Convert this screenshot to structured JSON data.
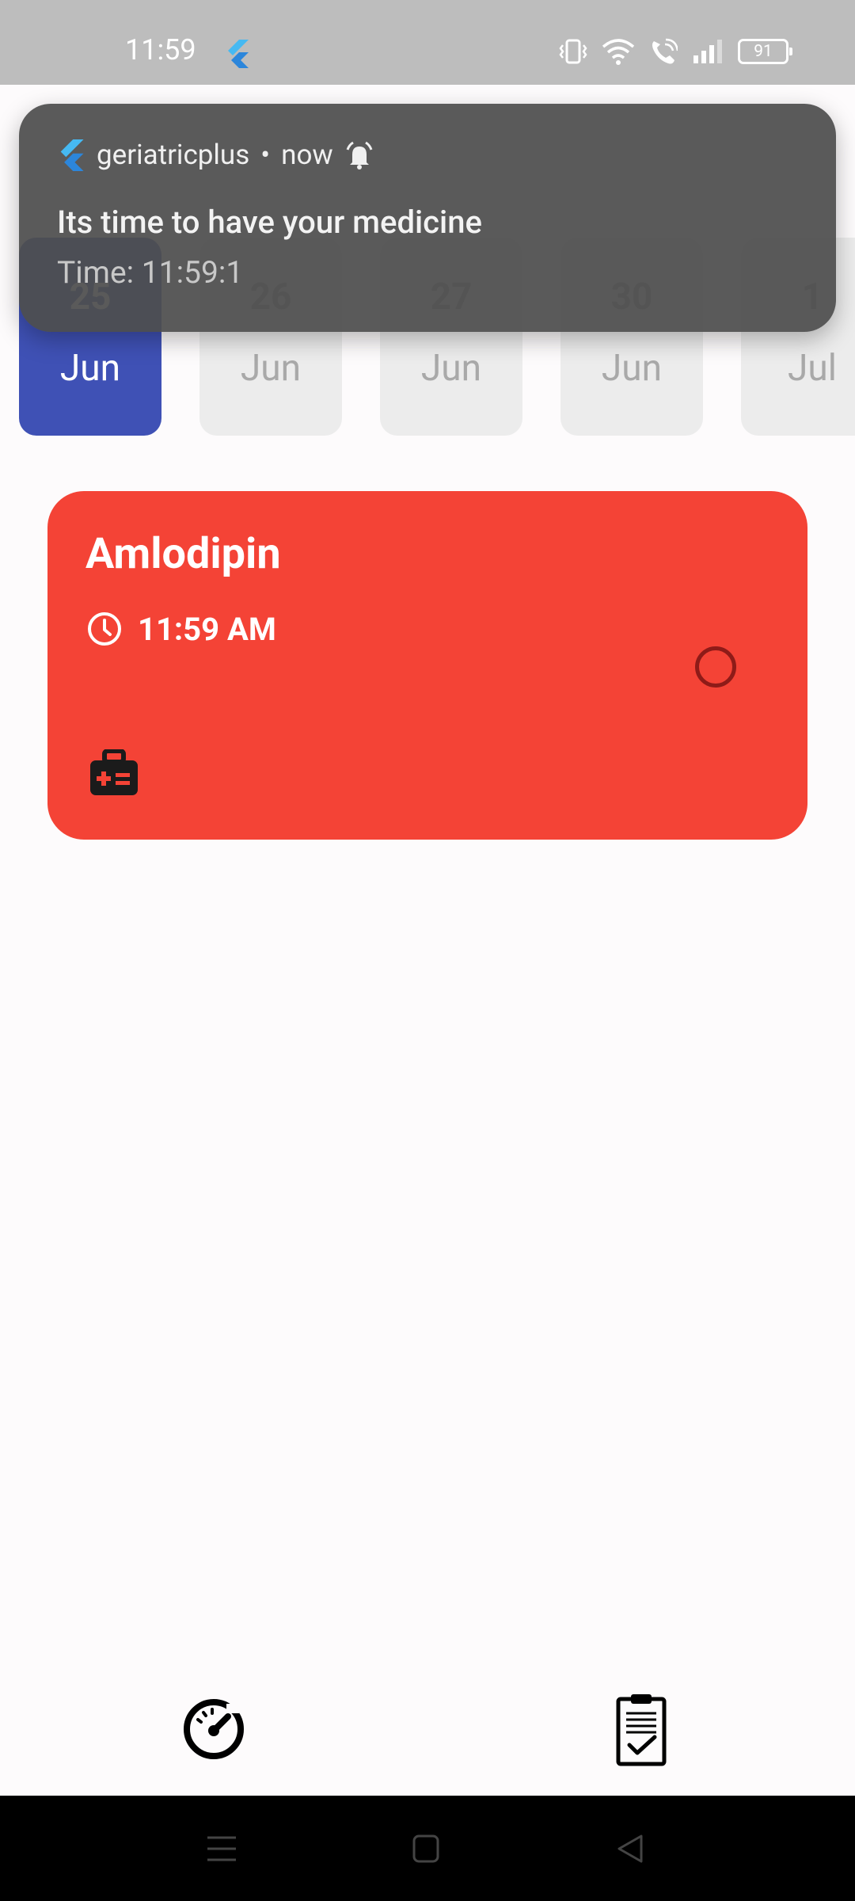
{
  "status_bar": {
    "time": "11:59",
    "battery": "91"
  },
  "notification": {
    "app_name": "geriatricplus",
    "separator": "•",
    "when": "now",
    "title": "Its time to have your medicine",
    "text": "Time: 11:59:1"
  },
  "date_strip": {
    "dates": [
      {
        "day": "25",
        "month": "Jun",
        "selected": true
      },
      {
        "day": "26",
        "month": "Jun",
        "selected": false
      },
      {
        "day": "27",
        "month": "Jun",
        "selected": false
      },
      {
        "day": "30",
        "month": "Jun",
        "selected": false
      },
      {
        "day": "1",
        "month": "Jul",
        "selected": false
      }
    ]
  },
  "medicine": {
    "name": "Amlodipin",
    "time": "11:59 AM",
    "taken": false
  },
  "bottom_nav": {
    "left_icon": "speedometer-icon",
    "right_icon": "clipboard-check-icon"
  },
  "colors": {
    "selected_date": "#3f51b5",
    "medicine_card": "#f44336"
  }
}
